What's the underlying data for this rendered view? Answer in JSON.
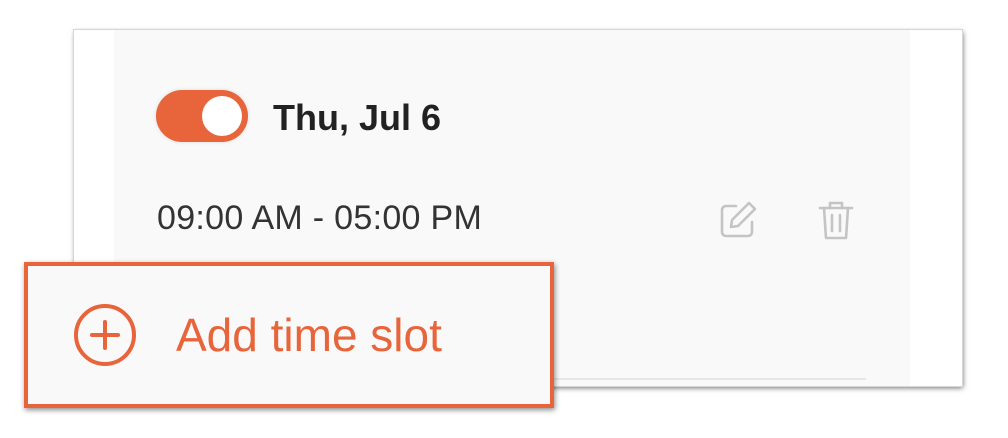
{
  "day": {
    "enabled": true,
    "label": "Thu, Jul 6"
  },
  "slots": [
    {
      "range": "09:00 AM - 05:00 PM"
    }
  ],
  "actions": {
    "add_slot_label": "Add time slot"
  },
  "icons": {
    "edit": "edit-icon",
    "delete": "trash-icon",
    "add": "plus-circle-icon"
  },
  "colors": {
    "accent": "#e8643a",
    "panel_bg": "#f9f9f9",
    "text": "#222222",
    "icon_muted": "#c4c4c4"
  }
}
